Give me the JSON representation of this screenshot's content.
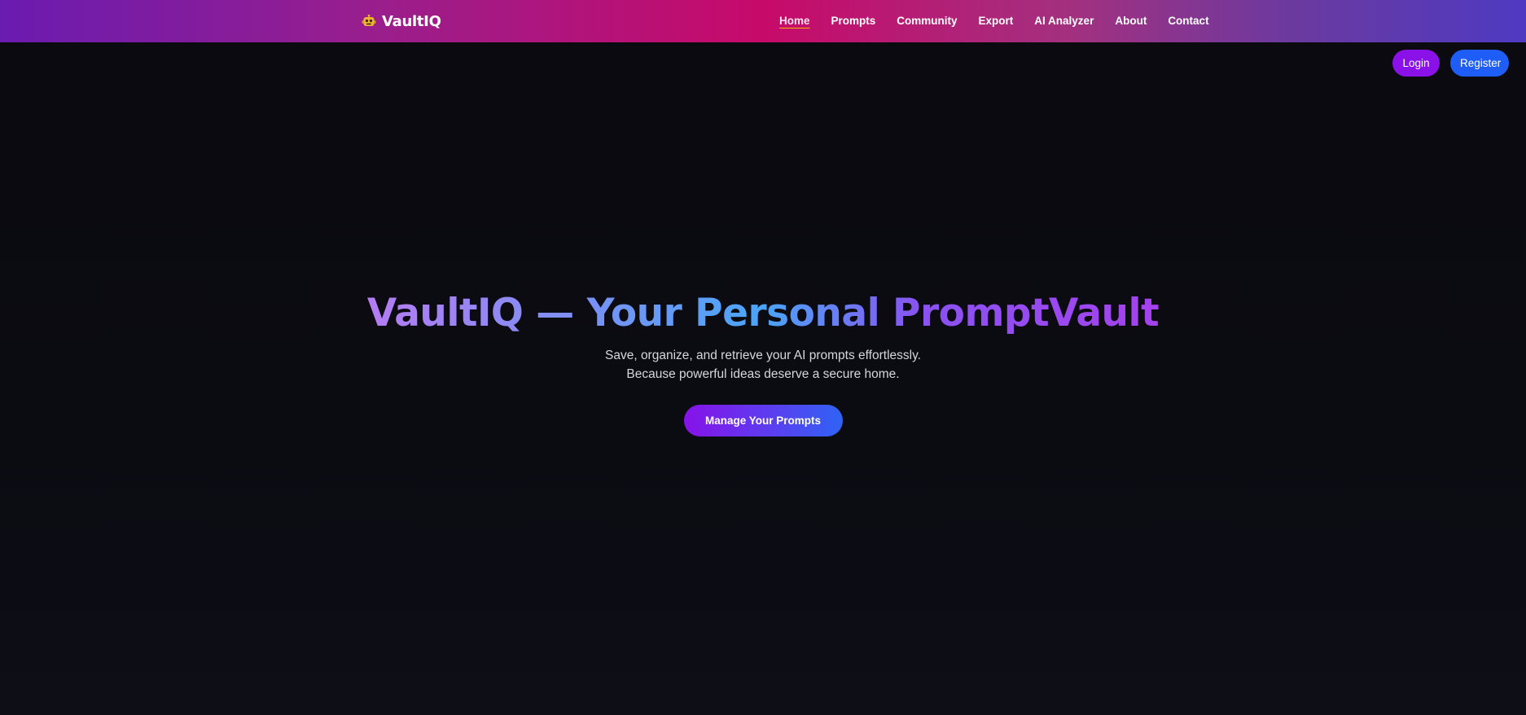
{
  "brand": {
    "name": "VaultIQ",
    "icon": "robot-icon"
  },
  "nav": {
    "items": [
      {
        "label": "Home",
        "active": true
      },
      {
        "label": "Prompts"
      },
      {
        "label": "Community"
      },
      {
        "label": "Export"
      },
      {
        "label": "AI Analyzer"
      },
      {
        "label": "About"
      },
      {
        "label": "Contact"
      }
    ]
  },
  "auth": {
    "login_label": "Login",
    "register_label": "Register"
  },
  "hero": {
    "title": "VaultIQ — Your Personal PromptVault",
    "subtitle_line1": "Save, organize, and retrieve your AI prompts effortlessly.",
    "subtitle_line2": "Because powerful ideas deserve a secure home.",
    "cta_label": "Manage Your Prompts"
  },
  "colors": {
    "login_button": "#8a11e8",
    "register_button": "#1e5ef7",
    "nav_active_underline": "#f5b700",
    "background": "#0a0a0f"
  }
}
